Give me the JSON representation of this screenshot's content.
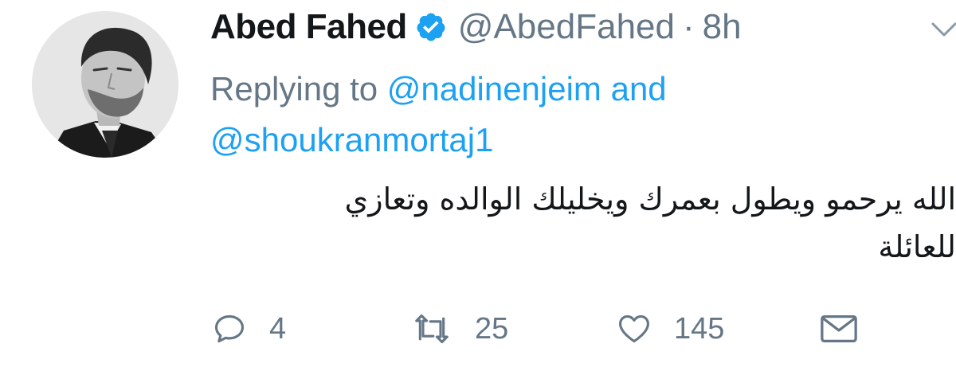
{
  "tweet": {
    "author": {
      "display_name": "Abed Fahed",
      "handle": "@AbedFahed",
      "verified": true,
      "avatar_icon": "profile-photo"
    },
    "separator": "·",
    "time": "8h",
    "replying": {
      "prefix": "Replying to",
      "mention_1": "@nadinenjeim",
      "conjunction": "and",
      "mention_2": "@shoukranmortaj1"
    },
    "text": "الله يرحمو ويطول بعمرك ويخليلك الوالده وتعازي\nللعائلة",
    "actions": {
      "reply": {
        "icon": "reply-icon",
        "count": "4"
      },
      "retweet": {
        "icon": "retweet-icon",
        "count": "25"
      },
      "like": {
        "icon": "heart-icon",
        "count": "145"
      },
      "dm": {
        "icon": "envelope-icon"
      }
    },
    "menu_icon": "chevron-down-icon"
  },
  "colors": {
    "text": "#14171a",
    "muted": "#657786",
    "link": "#1da1f2",
    "verified": "#1da1f2"
  }
}
